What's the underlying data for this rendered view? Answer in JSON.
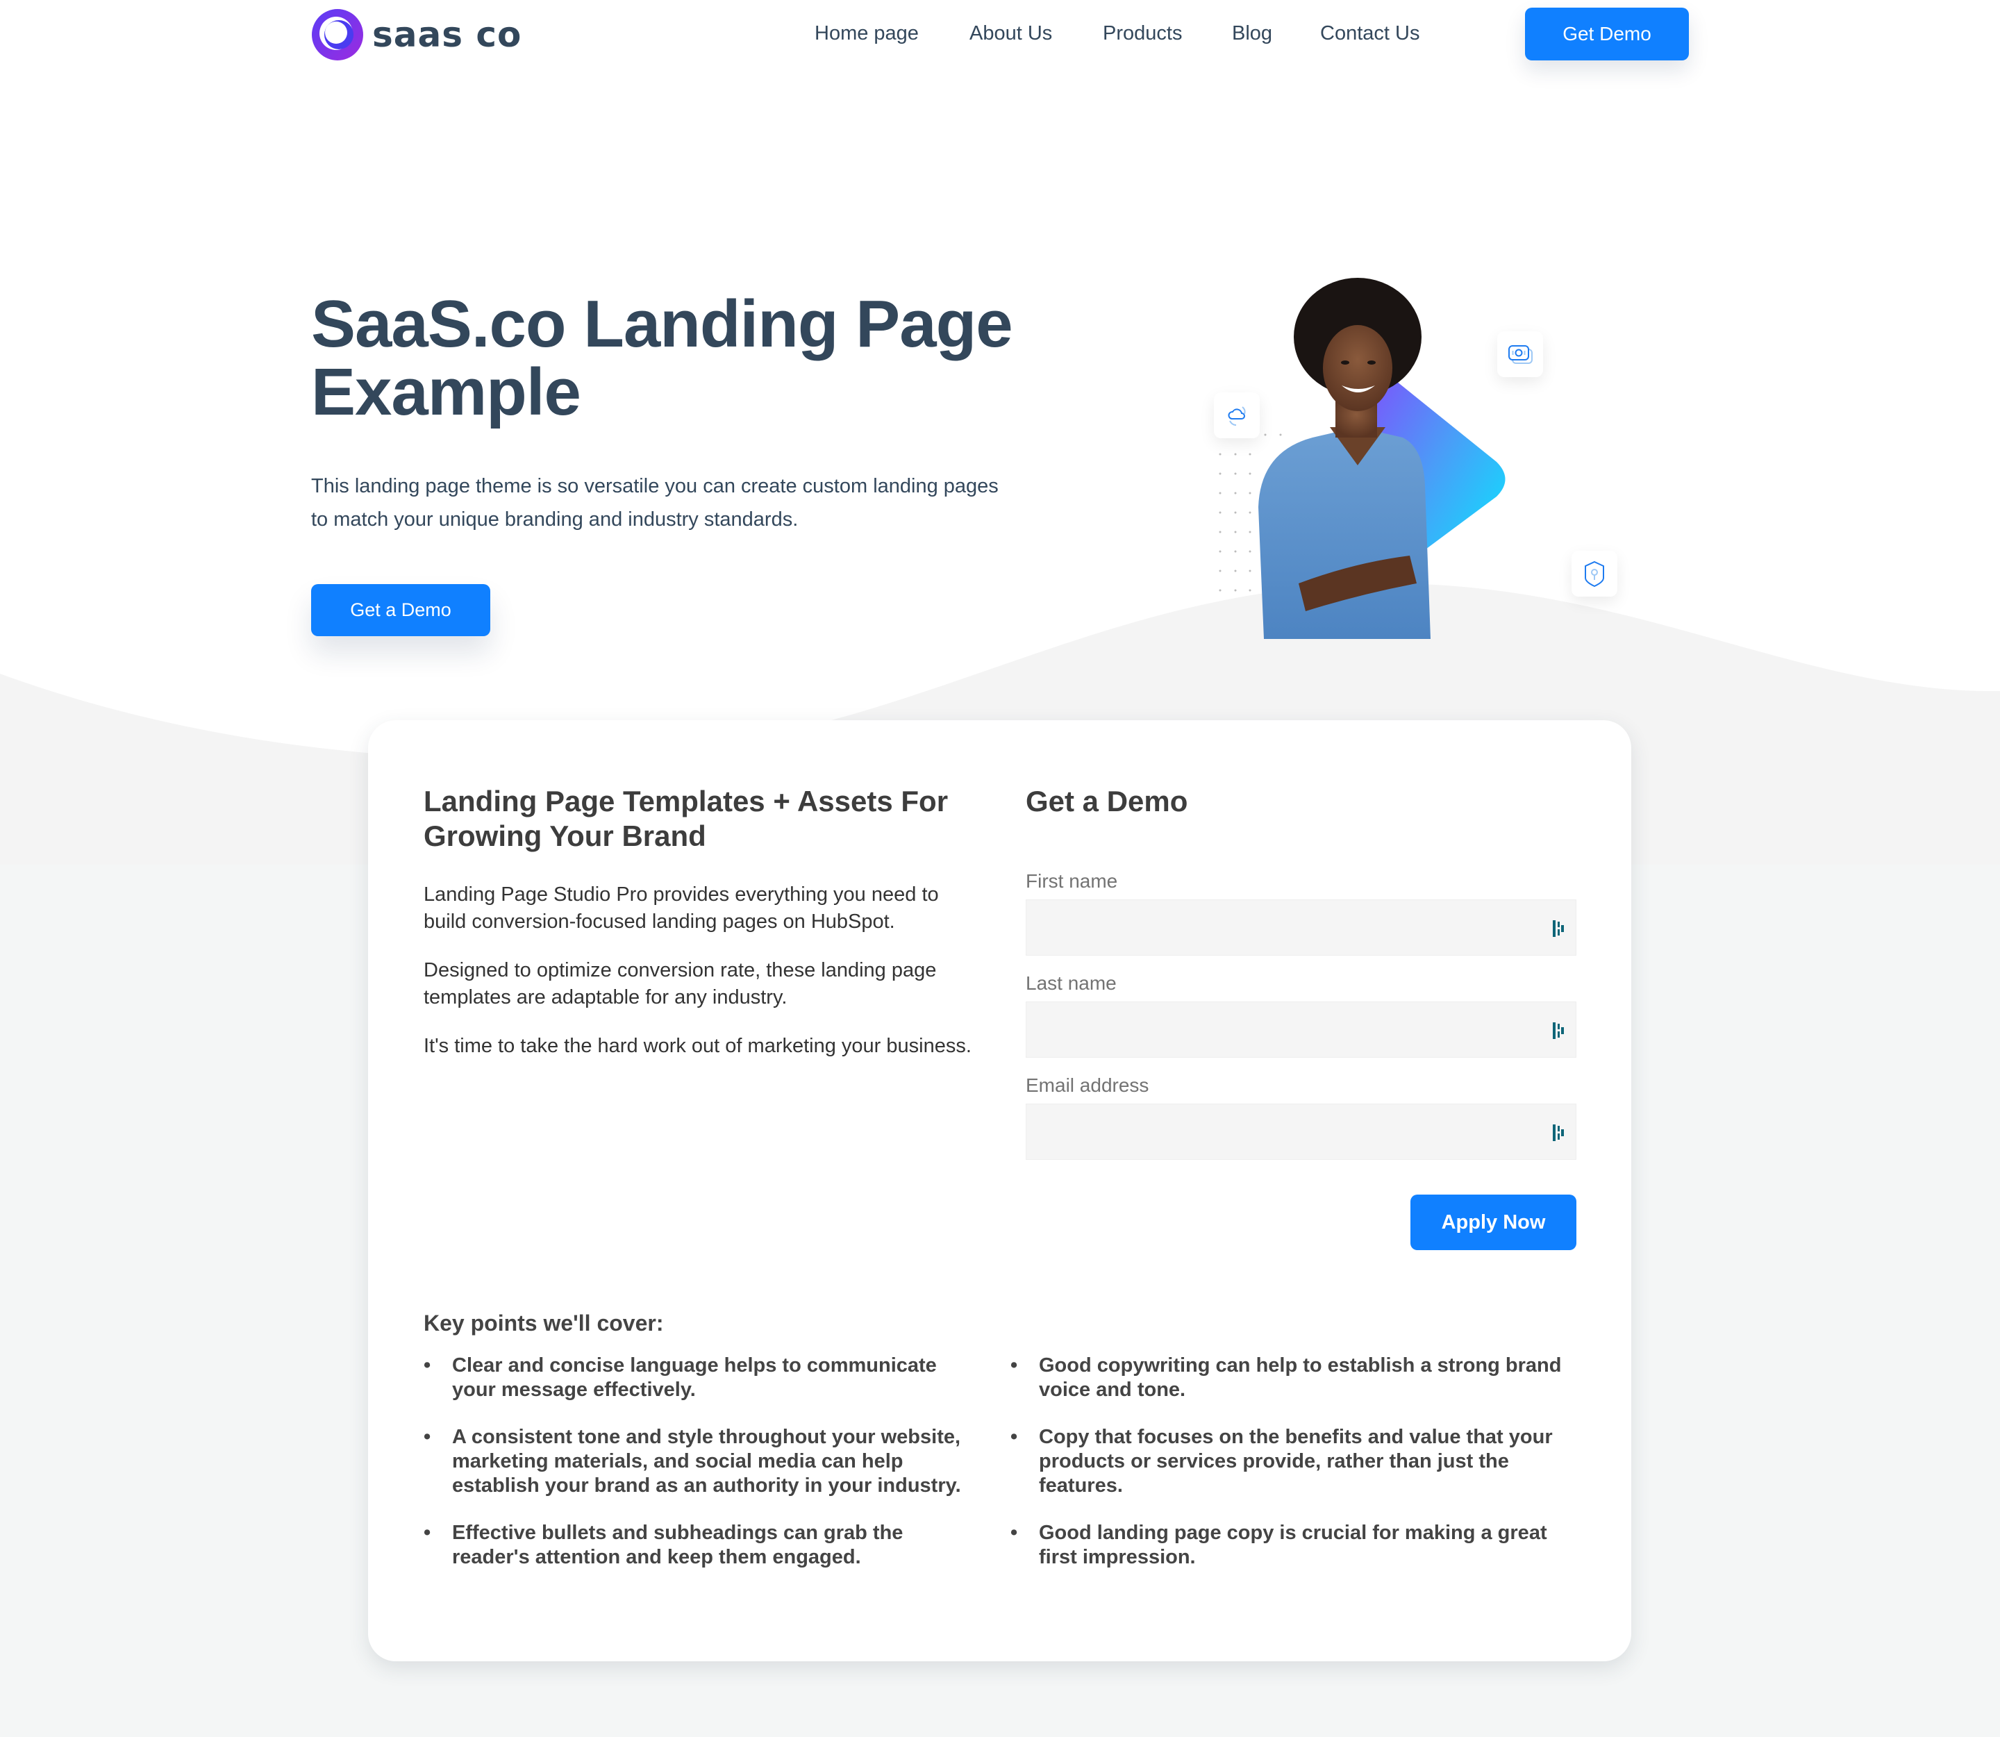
{
  "header": {
    "logo_text": "saas co",
    "nav": [
      "Home page",
      "About Us",
      "Products",
      "Blog",
      "Contact Us"
    ],
    "cta_label": "Get Demo"
  },
  "hero": {
    "title": "SaaS.co Landing Page Example",
    "subtitle": "This landing page theme is so versatile you can create custom landing pages to match your unique branding and industry standards.",
    "cta_label": "Get a Demo",
    "floating_icons": [
      "cloud-sync-icon",
      "camera-icon",
      "shield-key-icon"
    ]
  },
  "card": {
    "left": {
      "heading": "Landing Page Templates + Assets For Growing Your Brand",
      "paragraphs": [
        "Landing Page Studio Pro provides everything you need to build conversion-focused landing pages on HubSpot.",
        "Designed to optimize conversion rate, these landing page templates are adaptable for any industry.",
        "It's time to take the hard work out of marketing your business."
      ]
    },
    "form": {
      "heading": "Get a Demo",
      "fields": [
        {
          "label": "First name",
          "value": "",
          "placeholder": ""
        },
        {
          "label": "Last name",
          "value": "",
          "placeholder": ""
        },
        {
          "label": "Email address",
          "value": "",
          "placeholder": ""
        }
      ],
      "submit_label": "Apply Now"
    },
    "key_points": {
      "title": "Key points we'll cover:",
      "left": [
        "Clear and concise language helps to communicate your message effectively.",
        "A consistent tone and style throughout your website, marketing materials, and social media can help establish your brand as an authority in your industry.",
        "Effective bullets and subheadings can grab the reader's attention and keep them engaged."
      ],
      "right": [
        "Good copywriting can help to establish a strong brand voice and tone.",
        "Copy that focuses on the benefits and value that your products or services provide, rather than just the features.",
        "Good landing page copy is crucial for making a great first impression."
      ]
    }
  },
  "colors": {
    "accent": "#1080ff",
    "text_dark": "#33475b",
    "gradient_start": "#8a3ffc",
    "gradient_end": "#00f0ff",
    "page_bg": "#f4f6f6",
    "field_bg": "#f5f5f5",
    "pm_icon": "#0e6578"
  }
}
